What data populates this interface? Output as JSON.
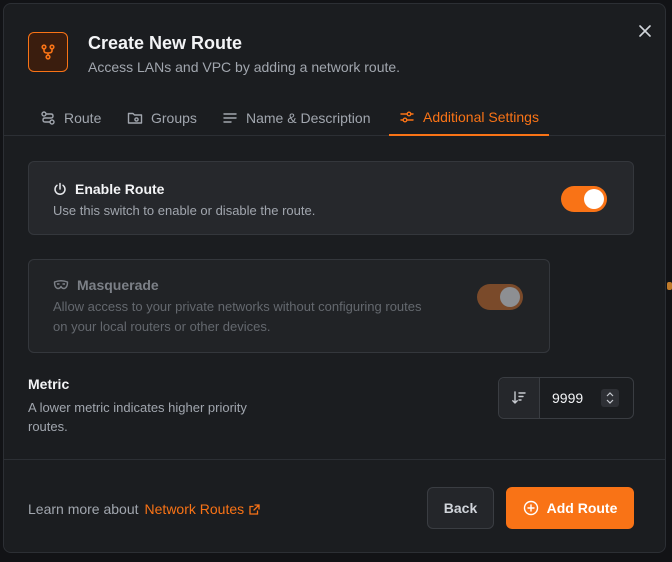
{
  "header": {
    "title": "Create New Route",
    "subtitle": "Access LANs and VPC by adding a network route.",
    "icon": "route-icon"
  },
  "tabs": [
    {
      "label": "Route",
      "icon": "route-icon"
    },
    {
      "label": "Groups",
      "icon": "folder-icon"
    },
    {
      "label": "Name & Description",
      "icon": "text-icon"
    },
    {
      "label": "Additional Settings",
      "icon": "settings-sliders-icon",
      "active": true
    }
  ],
  "enable_route": {
    "title": "Enable Route",
    "description": "Use this switch to enable or disable the route.",
    "enabled": true
  },
  "masquerade": {
    "title": "Masquerade",
    "description": "Allow access to your private networks without configuring routes on your local routers or other devices.",
    "enabled": true,
    "disabled": true
  },
  "metric": {
    "title": "Metric",
    "description": "A lower metric indicates higher priority routes.",
    "value": "9999"
  },
  "footer": {
    "learn_prefix": "Learn more about",
    "learn_link": "Network Routes",
    "back_label": "Back",
    "add_label": "Add Route"
  },
  "colors": {
    "accent": "#f97316",
    "background": "#1b1d20",
    "card": "#26282c"
  }
}
